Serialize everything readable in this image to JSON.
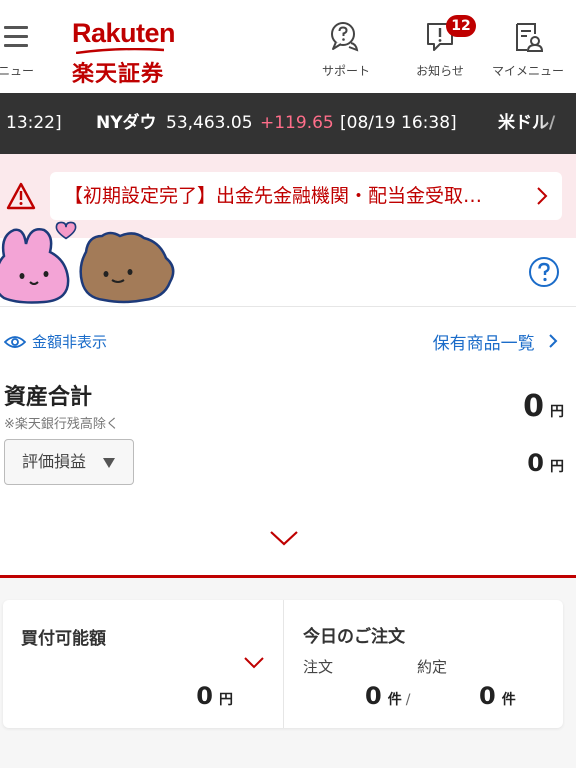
{
  "header": {
    "menu_label": "メニュー",
    "logo_top": "Rakuten",
    "logo_bottom": "楽天証券",
    "support_label": "サポート",
    "notice_label": "お知らせ",
    "notice_count": "12",
    "mymenu_label": "マイメニュー",
    "brand_color": "#bf0000",
    "icons": [
      "hamburger-icon",
      "support-chat-icon",
      "notice-icon",
      "mymenu-icon"
    ]
  },
  "ticker": {
    "prev_time": "13:22]",
    "index_name": "NYダウ",
    "index_value": "53,463.05",
    "index_change": "+119.65",
    "index_time": "[08/19 16:38]",
    "next_name": "米ドル/"
  },
  "alert": {
    "text": "【初期設定完了】出金先金融機関・配当金受取…",
    "color": "#bf0000",
    "background": "#fbe9ec"
  },
  "summary": {
    "hide_amount_label": "金額非表示",
    "holdings_link": "保有商品一覧",
    "total_label": "資産合計",
    "total_note": "※楽天銀行残高除く",
    "total_value": "0",
    "currency": "円",
    "eval_label": "評価損益",
    "eval_value": "0"
  },
  "buying_power": {
    "title": "買付可能額",
    "value": "0",
    "currency": "円"
  },
  "orders": {
    "title": "今日のご注文",
    "order_label": "注文",
    "executed_label": "約定",
    "order_count": "0",
    "executed_count": "0",
    "unit": "件",
    "separator": "/"
  }
}
